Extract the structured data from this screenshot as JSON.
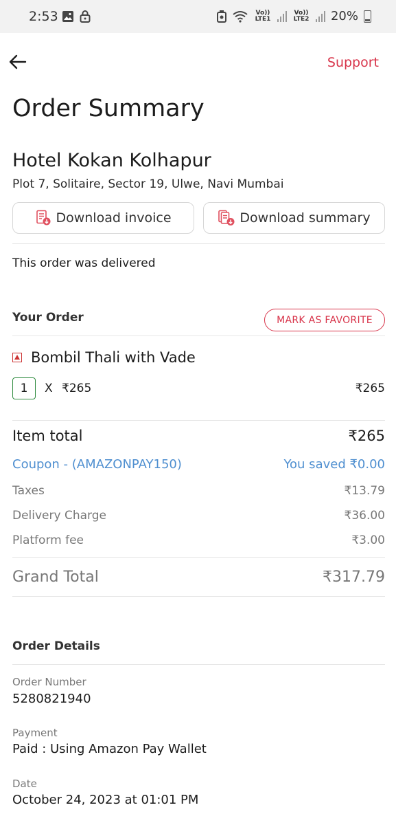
{
  "status_bar": {
    "time": "2:53",
    "sim1": "Vo)) LTE1",
    "sim2": "Vo)) LTE2",
    "battery": "20%"
  },
  "header": {
    "back_icon": "arrow-left-icon",
    "support_label": "Support"
  },
  "page_title": "Order Summary",
  "restaurant": {
    "name": "Hotel Kokan Kolhapur",
    "address": "Plot 7, Solitaire, Sector 19, Ulwe, Navi Mumbai"
  },
  "actions": {
    "download_invoice": "Download invoice",
    "download_summary": "Download summary"
  },
  "delivery_status": "This order was delivered",
  "your_order": {
    "title": "Your Order",
    "favorite_label": "MARK AS FAVORITE",
    "items": [
      {
        "name": "Bombil Thali with Vade",
        "qty": "1",
        "x": "X",
        "unit_price": "₹265",
        "total": "₹265"
      }
    ]
  },
  "bill": {
    "item_total_label": "Item total",
    "item_total_value": "₹265",
    "coupon_label": "Coupon - (AMAZONPAY150)",
    "coupon_value": "You saved ₹0.00",
    "taxes_label": "Taxes",
    "taxes_value": "₹13.79",
    "delivery_label": "Delivery Charge",
    "delivery_value": "₹36.00",
    "platform_label": "Platform fee",
    "platform_value": "₹3.00",
    "grand_total_label": "Grand Total",
    "grand_total_value": "₹317.79"
  },
  "order_details": {
    "title": "Order Details",
    "order_number_label": "Order Number",
    "order_number": "5280821940",
    "payment_label": "Payment",
    "payment_value": "Paid : Using Amazon Pay Wallet",
    "date_label": "Date",
    "date_value": "October 24, 2023 at 01:01 PM"
  },
  "colors": {
    "accent_red": "#d8344a",
    "coupon_blue": "#4f8fd0",
    "veg_green": "#2e8b3e"
  }
}
